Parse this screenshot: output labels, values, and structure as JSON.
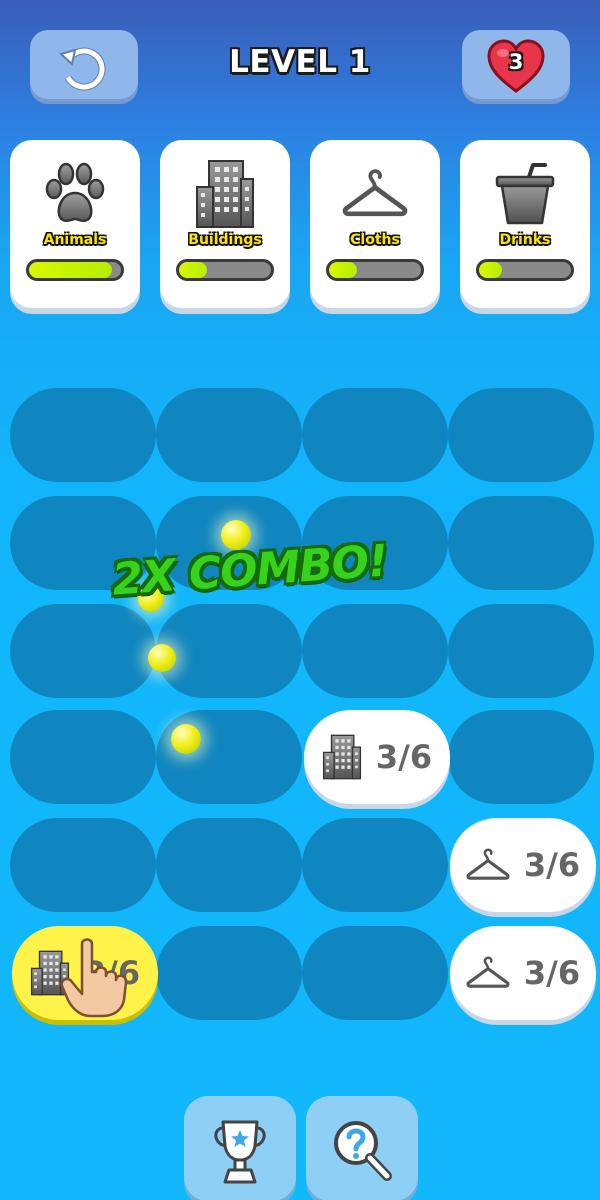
{
  "header": {
    "level_title": "LEVEL 1",
    "lives": "3",
    "reset_icon": "restart-icon",
    "lives_icon": "heart-icon"
  },
  "categories": [
    {
      "label": "Animals",
      "icon": "paw-icon",
      "progress": 0.9
    },
    {
      "label": "Buildings",
      "icon": "building-icon",
      "progress": 0.3
    },
    {
      "label": "Cloths",
      "icon": "hanger-icon",
      "progress": 0.3
    },
    {
      "label": "Drinks",
      "icon": "cup-icon",
      "progress": 0.25
    }
  ],
  "board": {
    "tiles": [
      {
        "icon": "building-icon",
        "count": "3/6"
      },
      {
        "icon": "hanger-icon",
        "count": "3/6"
      },
      {
        "icon": "hanger-icon",
        "count": "3/6"
      },
      {
        "icon": "building-icon",
        "count": "3/6",
        "selected": true
      }
    ]
  },
  "combo_text": "2X COMBO!",
  "bottom": {
    "trophy_icon": "trophy-icon",
    "hint_icon": "magnifier-question-icon"
  },
  "colors": {
    "background": "#12b8fb",
    "slot": "#0f86bf",
    "combo": "#38d21c",
    "bar_fill": "#c4f200",
    "label": "#ffe500"
  }
}
